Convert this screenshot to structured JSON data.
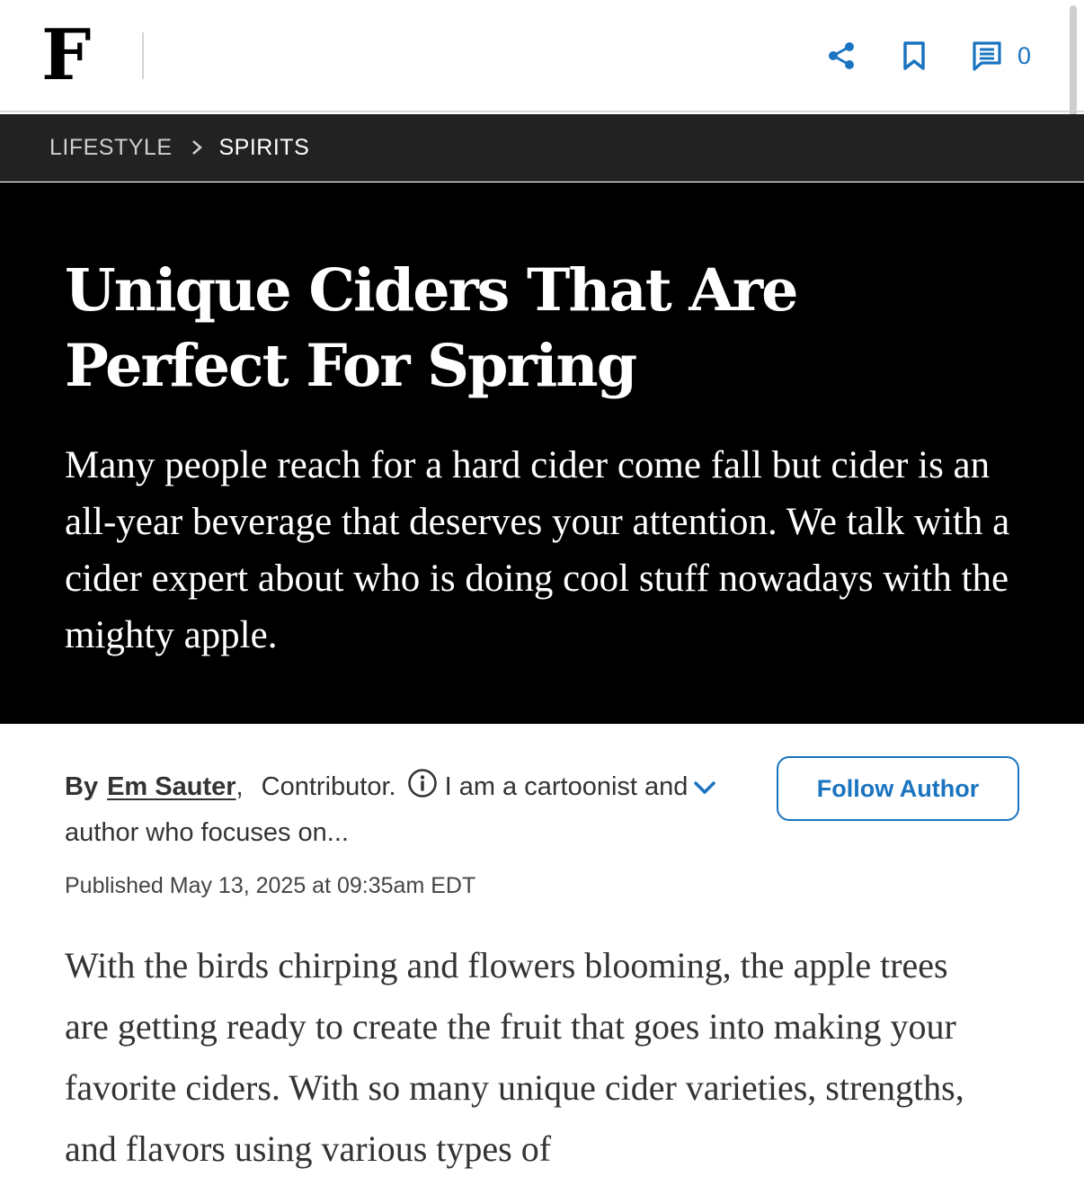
{
  "header": {
    "logo": "F",
    "comment_count": "0"
  },
  "breadcrumb": {
    "section": "LIFESTYLE",
    "subsection": "SPIRITS"
  },
  "article": {
    "headline": "Unique Ciders That Are Perfect For Spring",
    "dek": "Many people reach for a hard cider come fall but cider is an all-year beverage that deserves your attention. We talk with a cider expert about who is doing cool stuff nowadays with the mighty apple.",
    "byline": {
      "by_label": "By",
      "author": "Em Sauter",
      "comma": ",",
      "role": "Contributor.",
      "bio": "I am a cartoonist and author who focuses on...",
      "follow_label": "Follow Author"
    },
    "published": "Published May 13, 2025 at 09:35am EDT",
    "body_text": "With the birds chirping and flowers blooming, the apple trees are getting ready to create the fruit that goes into making your favorite ciders. With so many unique cider varieties, strengths, and flavors using various types of"
  },
  "colors": {
    "accent_blue": "#1a74c0",
    "hero_bg": "#000000",
    "breadcrumb_bg": "#222222"
  },
  "icons": [
    "share-icon",
    "bookmark-icon",
    "comment-icon",
    "chevron-right-icon",
    "info-icon",
    "chevron-down-icon"
  ]
}
